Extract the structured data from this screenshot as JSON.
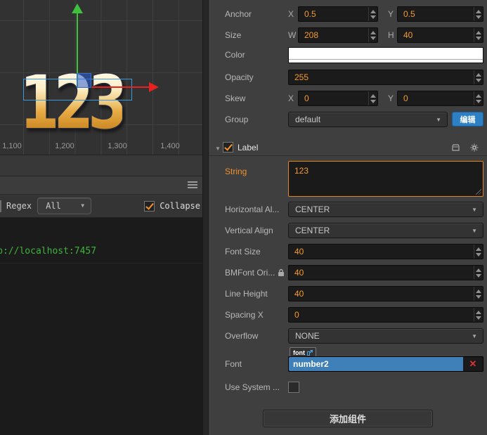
{
  "scene": {
    "label_text": "123",
    "ruler_ticks": [
      "1,100",
      "1,200",
      "1,300",
      "1,400"
    ],
    "colors": {
      "axis_y": "#3ec23e",
      "axis_x": "#e62222",
      "selection": "#3a9ae0",
      "gold_top": "#fffaee",
      "gold_bottom": "#b97a22"
    }
  },
  "console": {
    "filter_label": "Regex",
    "level_dropdown_value": "All",
    "collapse_label": "Collapse",
    "collapse_checked": true,
    "message": "://localhost:7457",
    "message_prefix_fragment": "p",
    "message_color": "#3cb43c"
  },
  "inspector": {
    "node": {
      "anchor": {
        "label": "Anchor",
        "x_label": "X",
        "x": "0.5",
        "y_label": "Y",
        "y": "0.5"
      },
      "size": {
        "label": "Size",
        "w_label": "W",
        "w": "208",
        "h_label": "H",
        "h": "40"
      },
      "color": {
        "label": "Color",
        "value_hex": "#ffffff"
      },
      "opacity": {
        "label": "Opacity",
        "value": "255"
      },
      "skew": {
        "label": "Skew",
        "x_label": "X",
        "x": "0",
        "y_label": "Y",
        "y": "0"
      },
      "group": {
        "label": "Group",
        "value": "default",
        "edit_button": "编辑"
      }
    },
    "label_component": {
      "title": "Label",
      "enabled": true,
      "string": {
        "label": "String",
        "value": "123"
      },
      "horizontal_align": {
        "label": "Horizontal Al...",
        "value": "CENTER"
      },
      "vertical_align": {
        "label": "Vertical Align",
        "value": "CENTER"
      },
      "font_size": {
        "label": "Font Size",
        "value": "40"
      },
      "bmfont_original": {
        "label": "BMFont Ori...",
        "value": "40"
      },
      "line_height": {
        "label": "Line Height",
        "value": "40"
      },
      "spacing_x": {
        "label": "Spacing X",
        "value": "0"
      },
      "overflow": {
        "label": "Overflow",
        "value": "NONE"
      },
      "font": {
        "label": "Font",
        "tag": "font",
        "value": "number2"
      },
      "use_system_font": {
        "label": "Use System ...",
        "checked": false
      }
    },
    "add_component_button": "添加组件"
  }
}
